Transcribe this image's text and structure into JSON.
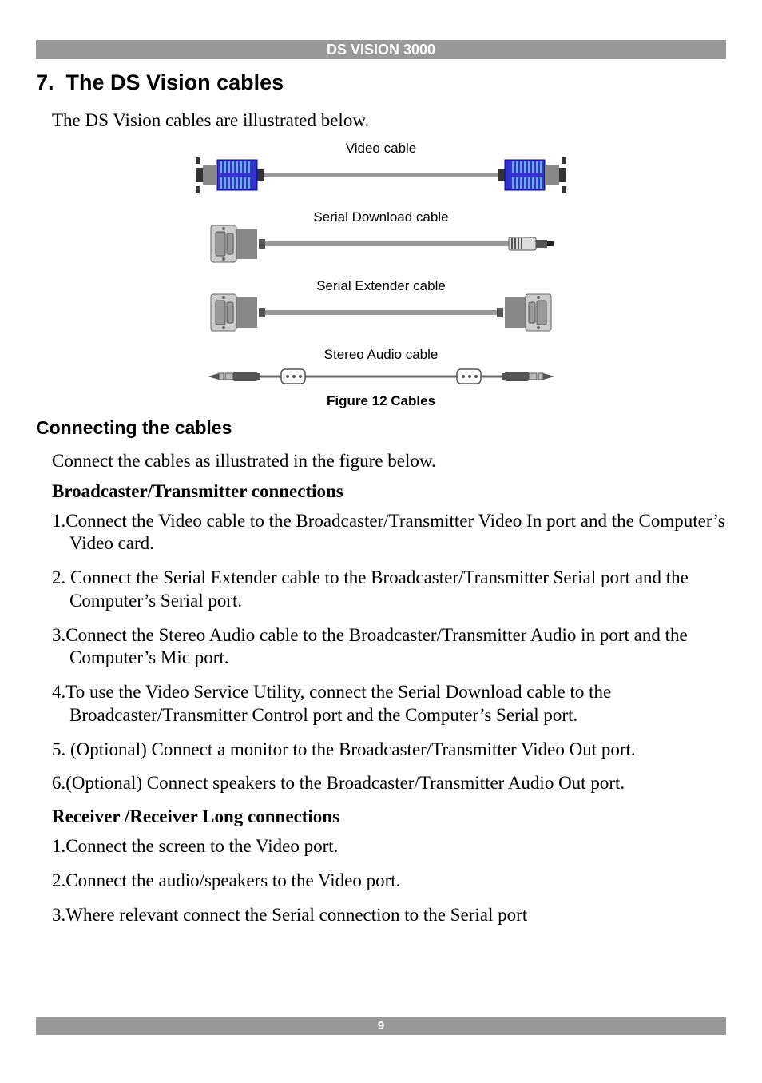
{
  "header": {
    "title": "DS VISION 3000"
  },
  "footer": {
    "page_number": "9"
  },
  "section": {
    "number": "7.",
    "title": "The DS Vision cables",
    "intro": "The DS Vision cables are illustrated below."
  },
  "diagram": {
    "cables": [
      {
        "label": "Video cable"
      },
      {
        "label": "Serial Download cable"
      },
      {
        "label": "Serial Extender cable"
      },
      {
        "label": "Stereo Audio cable"
      }
    ],
    "caption": "Figure 12 Cables"
  },
  "connecting": {
    "title": "Connecting the cables",
    "intro": "Connect the cables as illustrated in the figure below.",
    "broadcaster": {
      "title": "Broadcaster/Transmitter connections",
      "steps": [
        "Connect the Video cable to the Broadcaster/Transmitter Video In port and the Computer’s Video card.",
        " Connect the Serial Extender cable to the Broadcaster/Transmitter Serial port and the Computer’s Serial port.",
        "Connect the Stereo Audio cable to the Broadcaster/Transmitter Audio in port and the Computer’s Mic port.",
        "To use the Video Service Utility, connect the Serial Download cable to the Broadcaster/Transmitter Control port and the Computer’s Serial port.",
        " (Optional) Connect a monitor to the Broadcaster/Transmitter Video Out port.",
        "(Optional) Connect speakers to the Broadcaster/Transmitter Audio Out port."
      ]
    },
    "receiver": {
      "title": "Receiver /Receiver Long connections",
      "steps": [
        "Connect the screen to the Video port.",
        "Connect the audio/speakers to the Video port.",
        "Where relevant connect the Serial connection to the Serial port"
      ]
    }
  }
}
